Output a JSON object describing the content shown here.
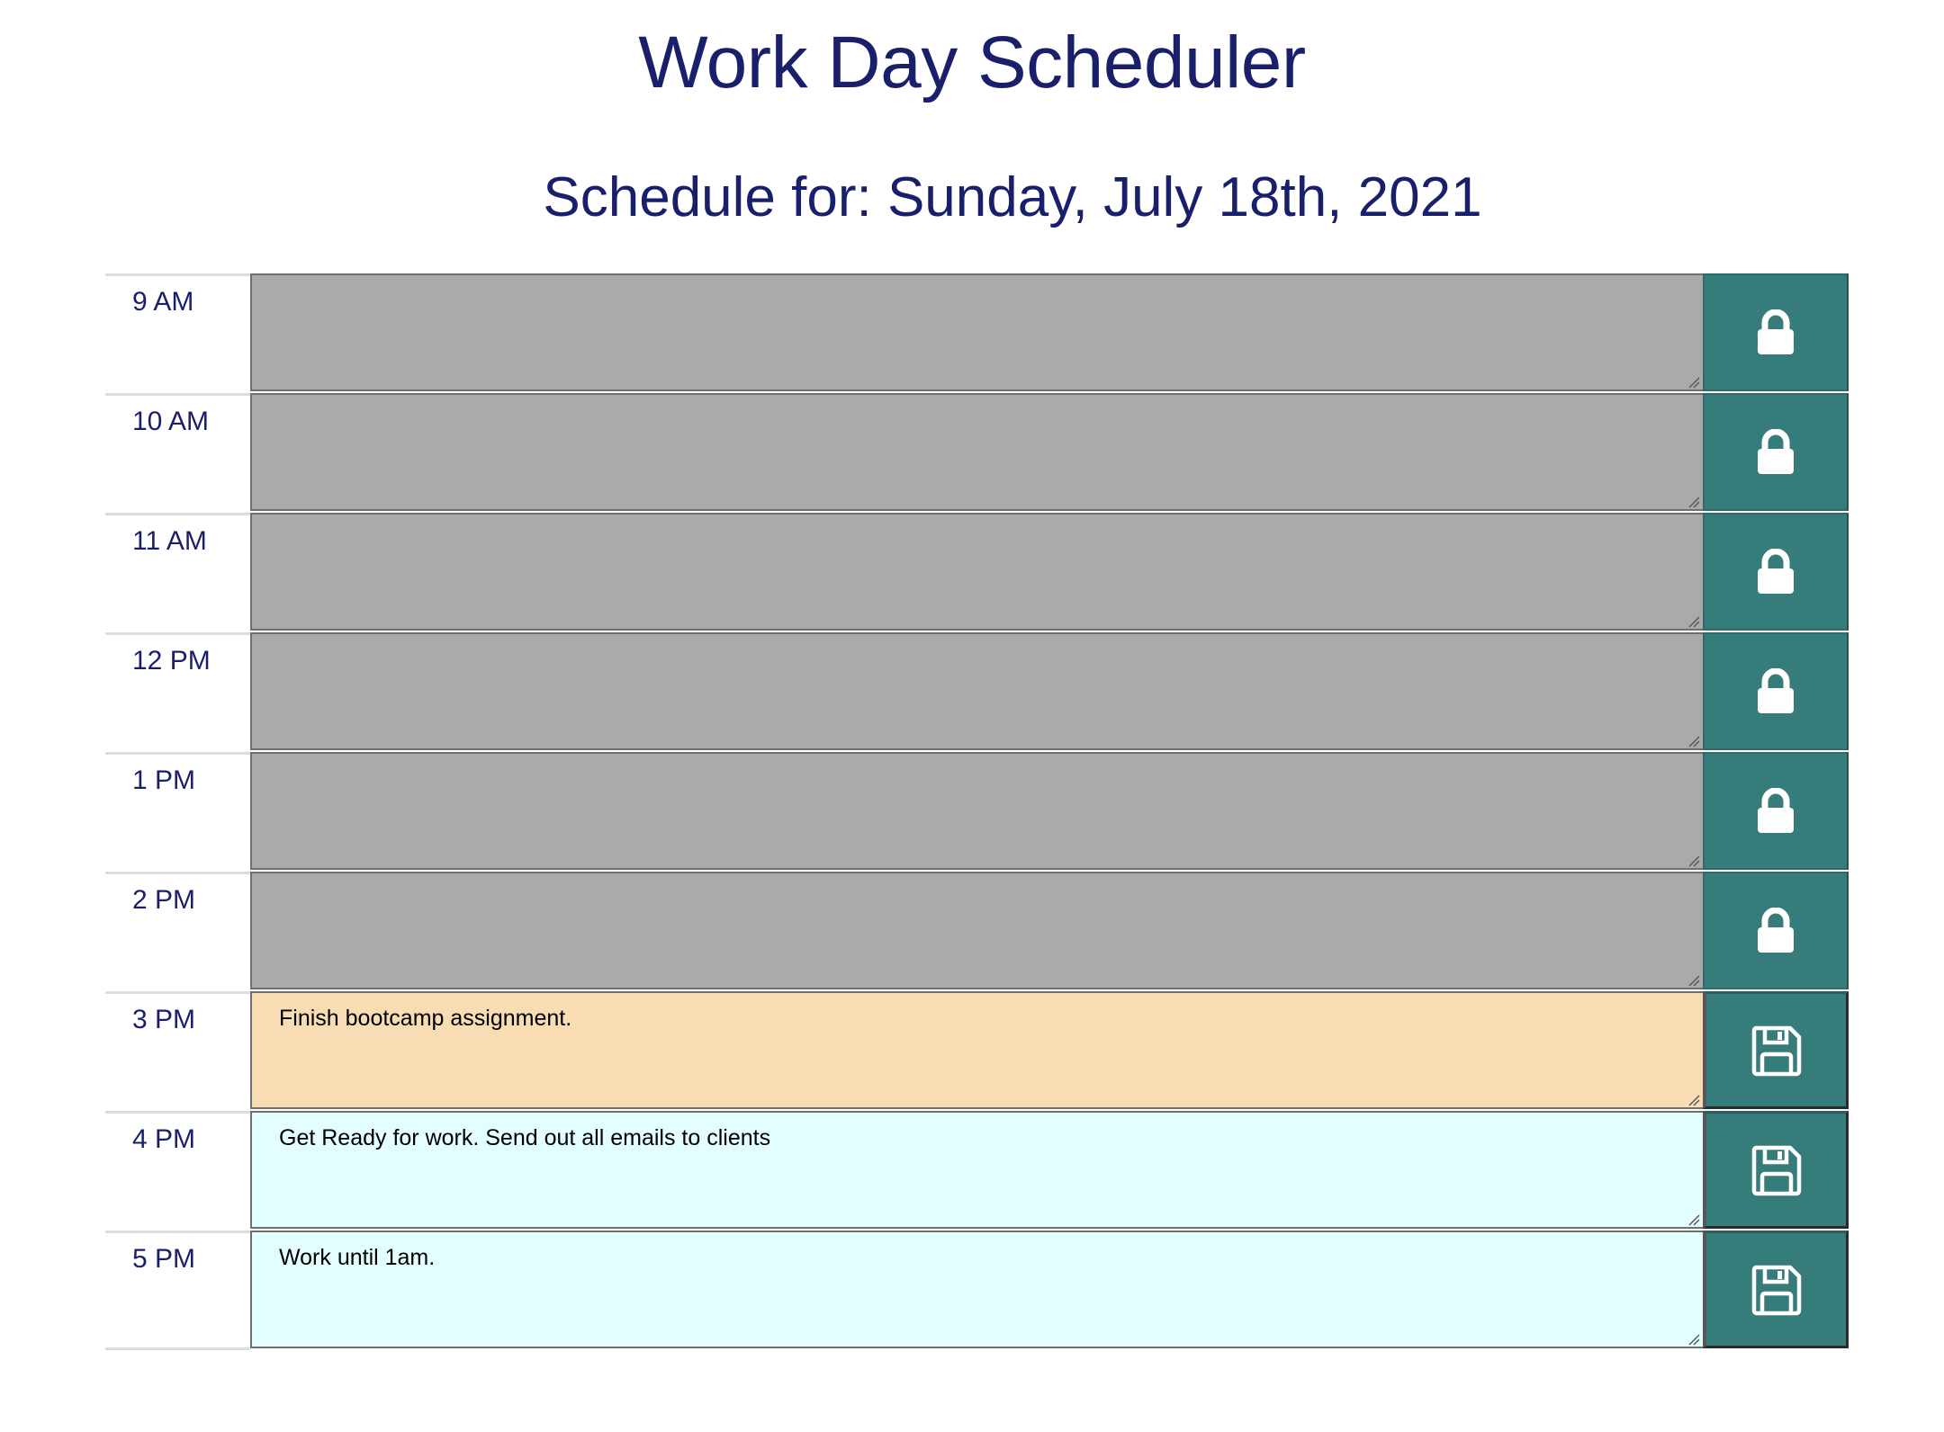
{
  "header": {
    "title": "Work Day Scheduler",
    "date_heading": "Schedule for: Sunday, July 18th, 2021"
  },
  "colors": {
    "past": "#aaaaaa",
    "present": "#f8dcb4",
    "future": "#e2feff",
    "button": "#367c7b",
    "heading": "#1a1f6b"
  },
  "schedule": {
    "rows": [
      {
        "hour": "9 AM",
        "text": "",
        "state": "past",
        "button_icon": "lock-icon"
      },
      {
        "hour": "10 AM",
        "text": "",
        "state": "past",
        "button_icon": "lock-icon"
      },
      {
        "hour": "11 AM",
        "text": "",
        "state": "past",
        "button_icon": "lock-icon"
      },
      {
        "hour": "12 PM",
        "text": "",
        "state": "past",
        "button_icon": "lock-icon"
      },
      {
        "hour": "1 PM",
        "text": "",
        "state": "past",
        "button_icon": "lock-icon"
      },
      {
        "hour": "2 PM",
        "text": "",
        "state": "past",
        "button_icon": "lock-icon"
      },
      {
        "hour": "3 PM",
        "text": "Finish bootcamp assignment.",
        "state": "present",
        "button_icon": "save-icon"
      },
      {
        "hour": "4 PM",
        "text": "Get Ready for work. Send out all emails to clients",
        "state": "future",
        "button_icon": "save-icon"
      },
      {
        "hour": "5 PM",
        "text": "Work until 1am.",
        "state": "future",
        "button_icon": "save-icon"
      }
    ]
  }
}
